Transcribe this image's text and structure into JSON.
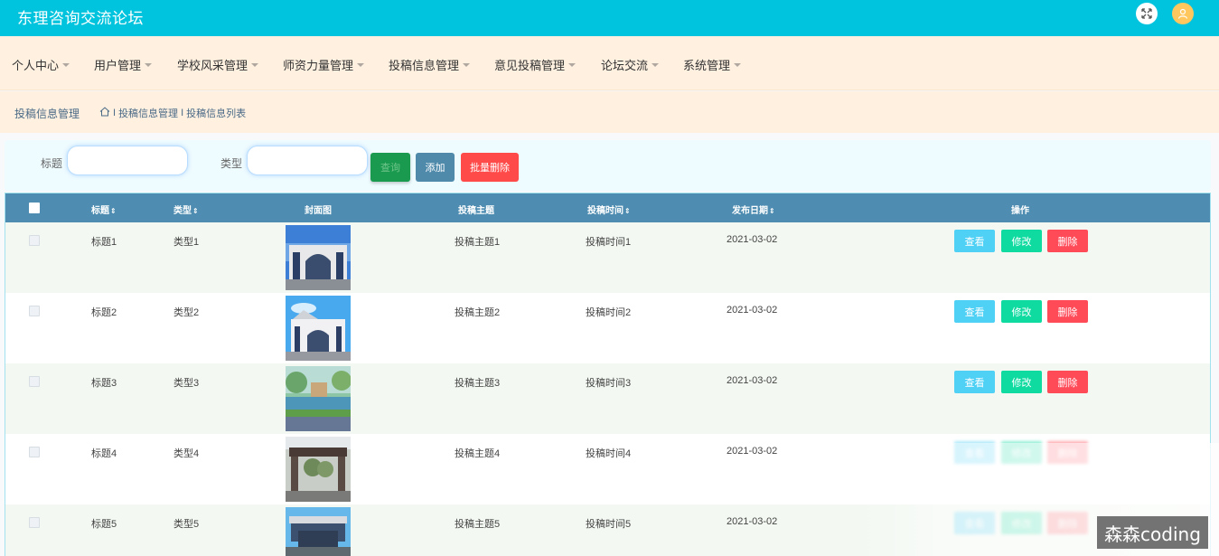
{
  "app": {
    "title": "东理咨询交流论坛",
    "header_icons": [
      "fullscreen-icon",
      "user-avatar-icon"
    ],
    "colors": {
      "header": "#00c4de",
      "nav_bg": "#fff0e0",
      "table_header": "#4e8db1",
      "search": "#1a9a4e",
      "add": "#4f8aab",
      "danger": "#ff4a4a",
      "view": "#4fd0f5",
      "edit": "#0fdba1"
    }
  },
  "nav": {
    "items": [
      {
        "label": "个人中心"
      },
      {
        "label": "用户管理"
      },
      {
        "label": "学校风采管理"
      },
      {
        "label": "师资力量管理"
      },
      {
        "label": "投稿信息管理"
      },
      {
        "label": "意见投稿管理"
      },
      {
        "label": "论坛交流"
      },
      {
        "label": "系统管理"
      }
    ]
  },
  "breadcrumb": {
    "page_title": "投稿信息管理",
    "home_icon": "home-icon",
    "items": [
      "投稿信息管理",
      "投稿信息列表"
    ],
    "separator": "I"
  },
  "search": {
    "fields": [
      {
        "label": "标题",
        "value": ""
      },
      {
        "label": "类型",
        "value": ""
      }
    ],
    "buttons": {
      "search": "查询",
      "add": "添加",
      "batch_delete": "批量删除"
    }
  },
  "table": {
    "columns": [
      "标题",
      "类型",
      "封面图",
      "投稿主题",
      "投稿时间",
      "发布日期",
      "操作"
    ],
    "sort_glyph": "⇕",
    "row_actions": {
      "view": "查看",
      "edit": "修改",
      "delete": "删除"
    },
    "rows": [
      {
        "title": "标题1",
        "type": "类型1",
        "cover": "campus-gate-photo",
        "topic": "投稿主题1",
        "time": "投稿时间1",
        "date": "2021-03-02"
      },
      {
        "title": "标题2",
        "type": "类型2",
        "cover": "campus-gate-sky-photo",
        "topic": "投稿主题2",
        "time": "投稿时间2",
        "date": "2021-03-02"
      },
      {
        "title": "标题3",
        "type": "类型3",
        "cover": "campus-lake-photo",
        "topic": "投稿主题3",
        "time": "投稿时间3",
        "date": "2021-03-02"
      },
      {
        "title": "标题4",
        "type": "类型4",
        "cover": "campus-gate-trees-photo",
        "topic": "投稿主题4",
        "time": "投稿时间4",
        "date": "2021-03-02"
      },
      {
        "title": "标题5",
        "type": "类型5",
        "cover": "campus-entrance-photo",
        "topic": "投稿主题5",
        "time": "投稿时间5",
        "date": "2021-03-02"
      }
    ]
  },
  "watermark": "森森coding"
}
